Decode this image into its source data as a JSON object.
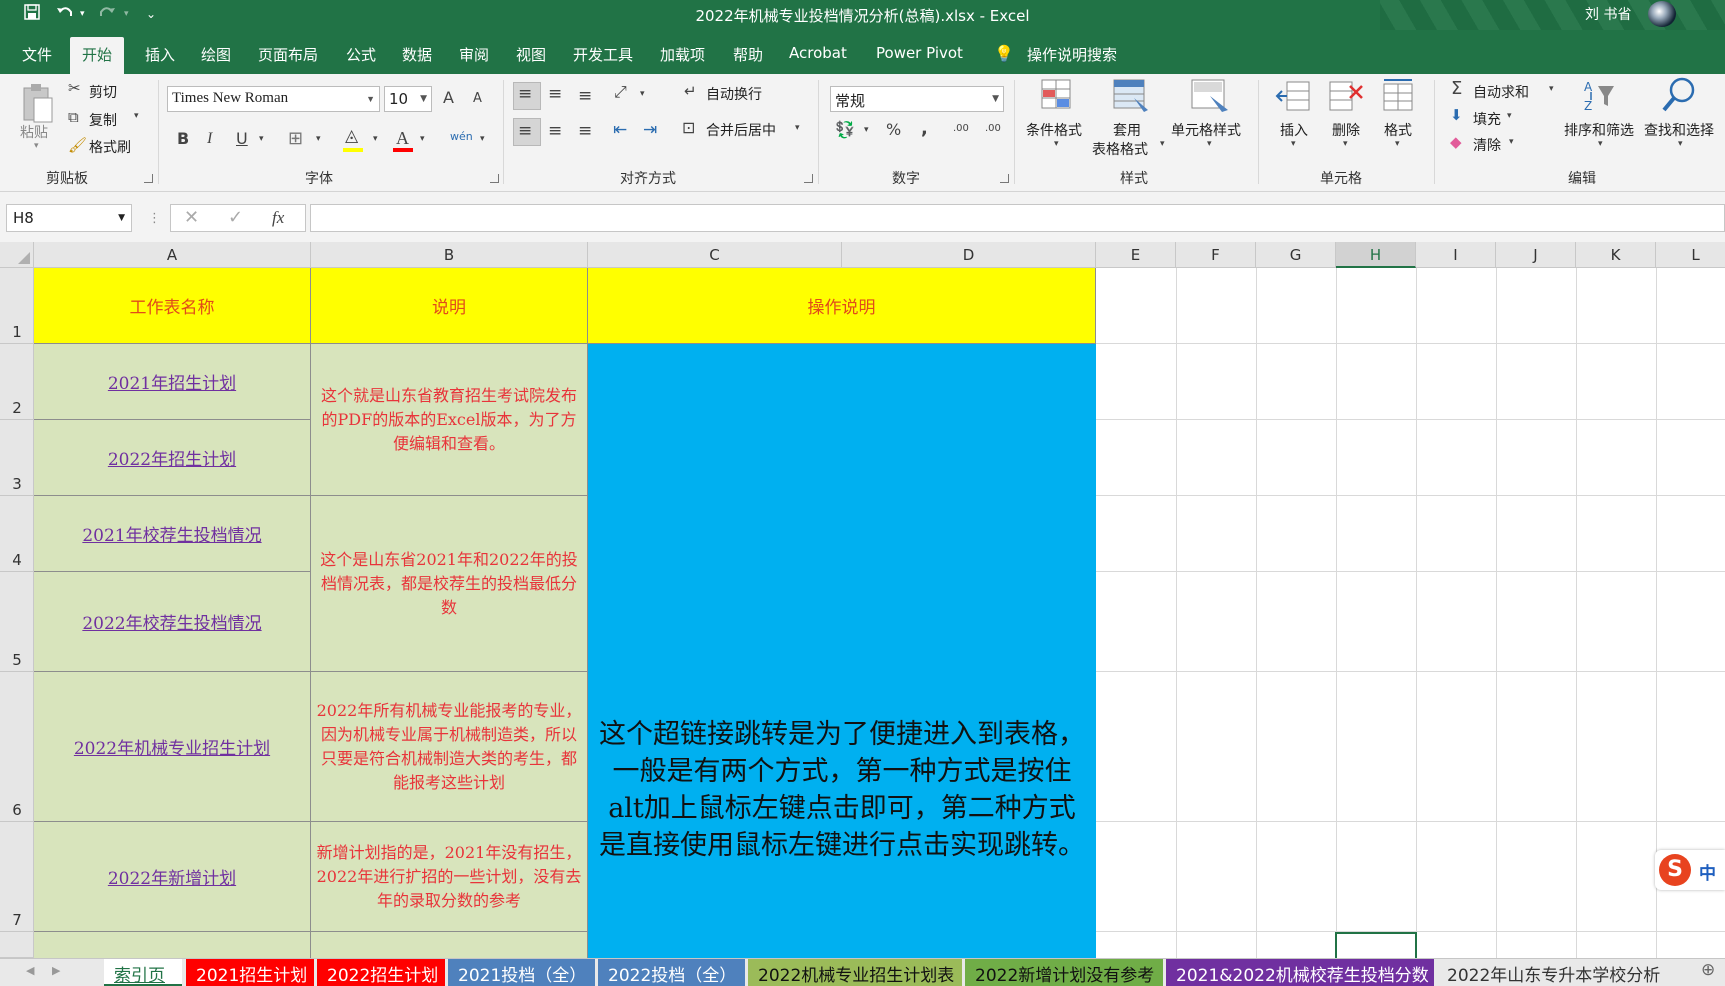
{
  "window": {
    "title": "2022年机械专业投档情况分析(总稿).xlsx  -  Excel",
    "user": "刘 书省"
  },
  "menu": {
    "tabs": [
      "文件",
      "开始",
      "插入",
      "绘图",
      "页面布局",
      "公式",
      "数据",
      "审阅",
      "视图",
      "开发工具",
      "加载项",
      "帮助",
      "Acrobat",
      "Power Pivot"
    ],
    "active_tab": "开始",
    "search_label": "操作说明搜索"
  },
  "ribbon": {
    "clipboard": {
      "paste": "粘贴",
      "cut": "剪切",
      "copy": "复制",
      "format_painter": "格式刷",
      "group": "剪贴板"
    },
    "font": {
      "name": "Times New Roman",
      "size": "10",
      "group": "字体",
      "bold": "B",
      "italic": "I",
      "underline": "U",
      "grow": "A",
      "shrink": "A",
      "font_color_letter": "A",
      "phonetic": "wén"
    },
    "alignment": {
      "wrap": "自动换行",
      "merge": "合并后居中",
      "group": "对齐方式"
    },
    "number": {
      "format": "常规",
      "group": "数字",
      "percent": "%",
      "comma": ",",
      "inc_decimal": ".00",
      "dec_decimal": ".00"
    },
    "styles": {
      "conditional": "条件格式",
      "table_format_1": "套用",
      "table_format_2": "表格格式",
      "cell_styles": "单元格样式",
      "group": "样式"
    },
    "cells": {
      "insert": "插入",
      "delete": "删除",
      "format": "格式",
      "group": "单元格"
    },
    "editing": {
      "autosum": "自动求和",
      "fill": "填充",
      "clear": "清除",
      "sort_filter": "排序和筛选",
      "find_select": "查找和选择",
      "group": "编辑"
    }
  },
  "formula_bar": {
    "name_box": "H8",
    "fx": "fx",
    "formula": ""
  },
  "grid": {
    "columns": [
      "A",
      "B",
      "C",
      "D",
      "E",
      "F",
      "G",
      "H",
      "I",
      "J",
      "K",
      "L"
    ],
    "selected_column": "H",
    "rows": [
      "1",
      "2",
      "3",
      "4",
      "5",
      "6",
      "7"
    ],
    "header": {
      "a": "工作表名称",
      "b": "说明",
      "c": "操作说明"
    },
    "links": [
      "2021年招生计划",
      "2022年招生计划",
      "2021年校荐生投档情况",
      "2022年校荐生投档情况",
      "2022年机械专业招生计划",
      "2022年新增计划"
    ],
    "notes": [
      "这个就是山东省教育招生考试院发布的PDF的版本的Excel版本，为了方便编辑和查看。",
      "这个是山东省2021年和2022年的投档情况表，都是校荐生的投档最低分数",
      "2022年所有机械专业能报考的专业，因为机械专业属于机械制造类，所以只要是符合机械制造大类的考生，都能报考这些计划",
      "新增计划指的是，2021年没有招生，2022年进行扩招的一些计划，没有去年的录取分数的参考"
    ],
    "instruction": "这个超链接跳转是为了便捷进入到表格，一般是有两个方式，第一种方式是按住alt加上鼠标左键点击即可，第二种方式是直接使用鼠标左键进行点击实现跳转。"
  },
  "sheet_tabs": [
    {
      "label": "索引页",
      "color": "#ffffff",
      "active": true
    },
    {
      "label": "2021招生计划",
      "color": "#ff0000"
    },
    {
      "label": "2022招生计划",
      "color": "#ff0000"
    },
    {
      "label": "2021投档（全）",
      "color": "#4f81bd"
    },
    {
      "label": "2022投档（全）",
      "color": "#4f81bd"
    },
    {
      "label": "2022机械专业招生计划表",
      "color": "#9bbb59"
    },
    {
      "label": "2022新增计划没有参考",
      "color": "#70ad47"
    },
    {
      "label": "2021&2022机械校荐生投档分数",
      "color": "#7030a0"
    },
    {
      "label": "2022年山东专升本学校分析",
      "color": "#e9e9e9"
    }
  ],
  "ime": {
    "label": "中"
  }
}
